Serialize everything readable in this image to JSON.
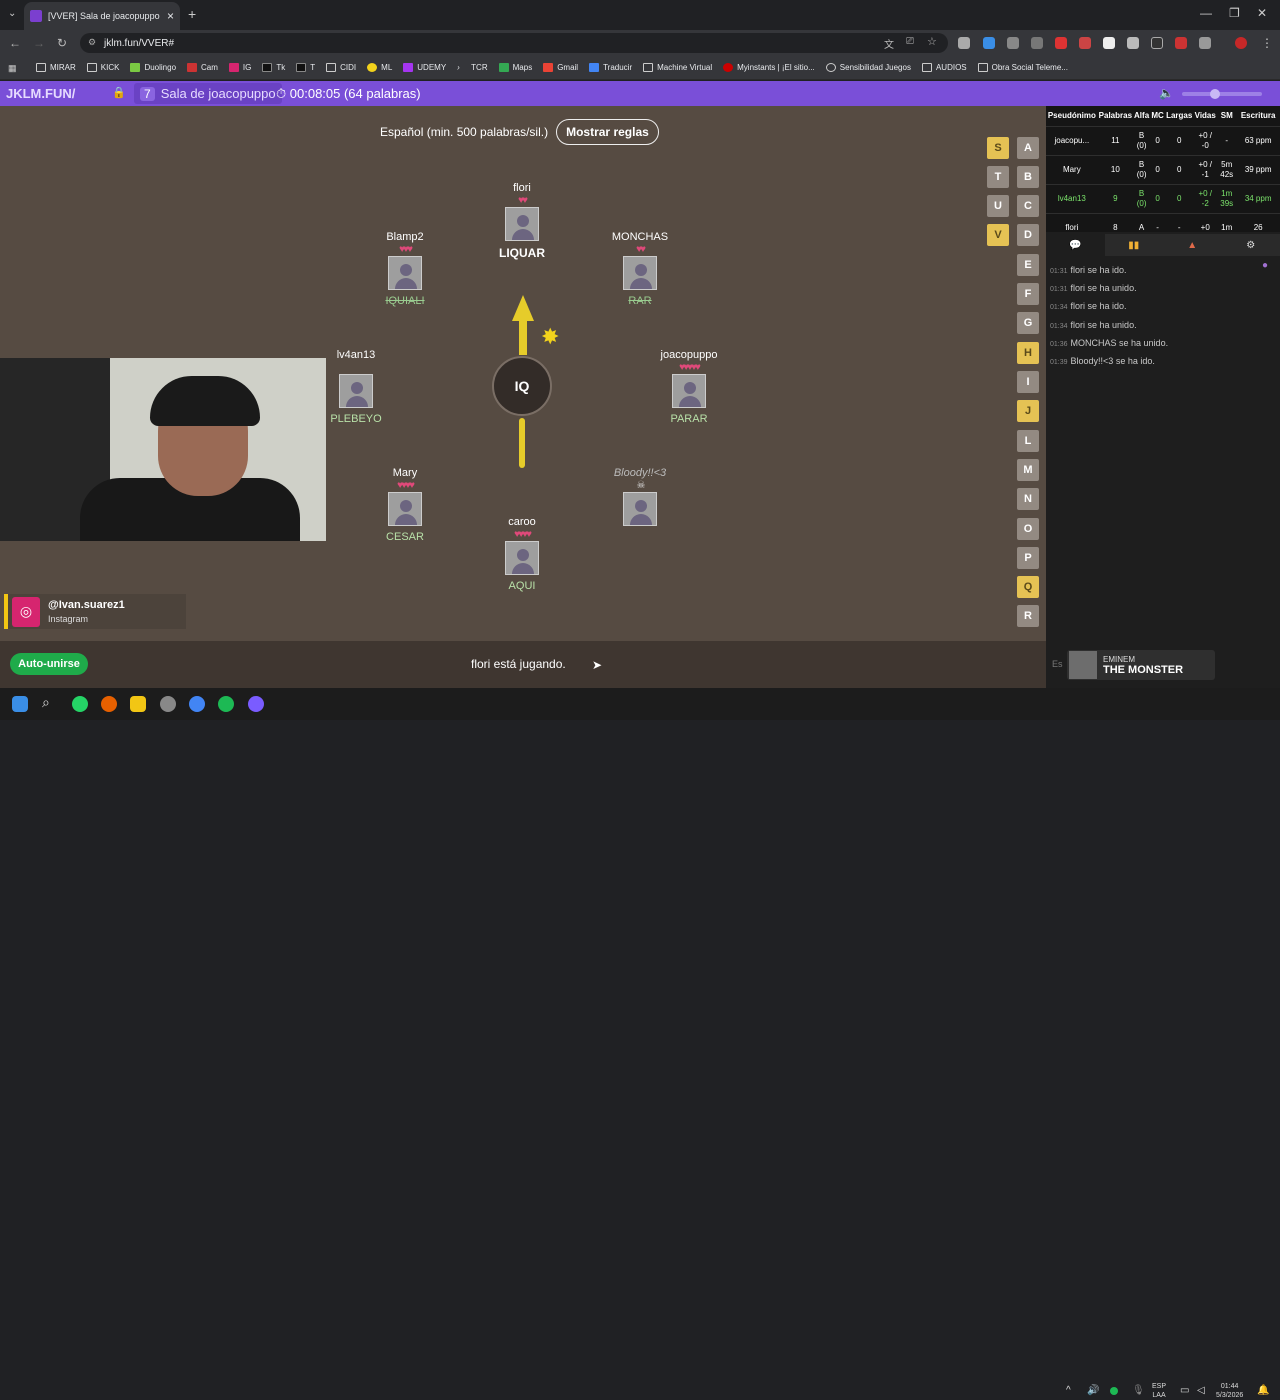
{
  "browser": {
    "tab_title": "[VVER] Sala de joacopuppo",
    "url": "jklm.fun/VVER#",
    "bookmarks": [
      "MIRAR",
      "KICK",
      "Duolingo",
      "Cam",
      "IG",
      "Tk",
      "T",
      "CIDI",
      "ML",
      "UDEMY",
      "TCR",
      "Maps",
      "Gmail",
      "Traducir",
      "Machine Virtual",
      "Myinstants | ¡El sitio...",
      "Sensibilidad Juegos",
      "AUDIOS",
      "Obra Social Teleme..."
    ]
  },
  "header": {
    "site": "JKLM.FUN/",
    "room_number": "7",
    "room_name": "Sala de joacopuppo",
    "timer": "00:08:05 (64 palabras)"
  },
  "game": {
    "language_line": "Español (min. 500 palabras/sil.)",
    "rules_button": "Mostrar reglas",
    "syllable": "IQ",
    "status": "flori está jugando.",
    "auto_join": "Auto-unirse"
  },
  "players": [
    {
      "name": "flori",
      "hearts": "♥♥",
      "word": "LIQUAR"
    },
    {
      "name": "Blamp2",
      "hearts": "♥♥♥",
      "word": "IQUIALI"
    },
    {
      "name": "MONCHAS",
      "hearts": "♥♥",
      "word": "RAR"
    },
    {
      "name": "lv4an13",
      "hearts": "",
      "word": "PLEBEYO"
    },
    {
      "name": "joacopuppo",
      "hearts": "♥♥♥♥♥",
      "word": "PARAR"
    },
    {
      "name": "Mary",
      "hearts": "♥♥♥♥",
      "word": "CESAR"
    },
    {
      "name": "caroo",
      "hearts": "♥♥♥♥",
      "word": "AQUI"
    },
    {
      "name": "Bloody!!<3",
      "hearts": "",
      "word": ""
    }
  ],
  "letters_left": [
    "S",
    "T",
    "U",
    "V"
  ],
  "letters_right": [
    "A",
    "B",
    "C",
    "D",
    "E",
    "F",
    "G",
    "H",
    "I",
    "J",
    "L",
    "M",
    "N",
    "O",
    "P",
    "Q",
    "R"
  ],
  "letters_active": [
    "S",
    "V",
    "H",
    "J",
    "Q"
  ],
  "stats": {
    "headers": [
      "Pseudónimo",
      "Palabras",
      "Alfa",
      "MC",
      "Largas",
      "Vidas",
      "SM",
      "Escritura"
    ],
    "rows": [
      [
        "joacopu...",
        "11",
        "B (0)",
        "0",
        "0",
        "+0 / -0",
        "-",
        "63 ppm"
      ],
      [
        "Mary",
        "10",
        "B (0)",
        "0",
        "0",
        "+0 / -1",
        "5m 42s",
        "39 ppm"
      ],
      [
        "lv4an13",
        "9",
        "B (0)",
        "0",
        "0",
        "+0 / -2",
        "1m 39s",
        "34 ppm"
      ],
      [
        "flori",
        "8",
        "A",
        "-",
        "-",
        "+0",
        "1m",
        "26"
      ]
    ]
  },
  "chat": [
    {
      "time": "01:31",
      "text": "flori se ha ido."
    },
    {
      "time": "01:31",
      "text": "flori se ha unido."
    },
    {
      "time": "01:34",
      "text": "flori se ha ido."
    },
    {
      "time": "01:34",
      "text": "flori se ha unido."
    },
    {
      "time": "01:36",
      "text": "MONCHAS se ha unido."
    },
    {
      "time": "01:39",
      "text": "Bloody!!<3 se ha ido."
    }
  ],
  "chat_placeholder": "Es",
  "instagram": {
    "handle": "@Ivan.suarez1",
    "label": "Instagram"
  },
  "spotify": {
    "artist": "EMINEM",
    "song": "THE MONSTER"
  },
  "taskbar": {
    "lang1": "ESP",
    "lang2": "LAA",
    "time": "01:44",
    "date": "5/3/2026"
  },
  "colors": {
    "accent": "#7a4fd8",
    "game_bg": "#564b42",
    "active_letter": "#e5c254",
    "auto_join": "#1fab4a",
    "heart": "#e0497a"
  }
}
